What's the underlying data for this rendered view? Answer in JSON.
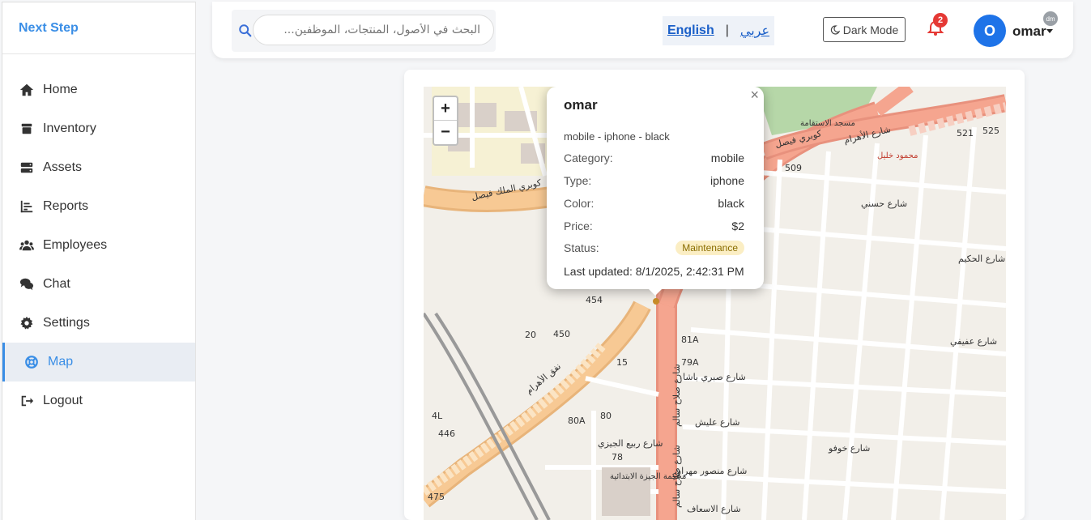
{
  "brand": "Next Step",
  "sidebar": {
    "items": [
      {
        "label": "Home"
      },
      {
        "label": "Inventory"
      },
      {
        "label": "Assets"
      },
      {
        "label": "Reports"
      },
      {
        "label": "Employees"
      },
      {
        "label": "Chat"
      },
      {
        "label": "Settings"
      },
      {
        "label": "Map"
      },
      {
        "label": "Logout"
      }
    ],
    "active": "Map"
  },
  "header": {
    "search_placeholder": "البحث في الأصول، المنتجات، الموظفين...",
    "lang_en": "English",
    "lang_sep": "|",
    "lang_ar": "عربي",
    "dark_mode": "Dark Mode",
    "notif_count": "2",
    "avatar_initial": "O",
    "user_name": "omar",
    "dm_badge": "dm"
  },
  "map": {
    "zoom_in": "+",
    "zoom_out": "−",
    "labels": {
      "kobry_faisal": "كوبري الملك فيصل",
      "kobry_faisal2": "كوبري فيصل",
      "haram": "شارع الأهرام",
      "nafaq": "نفق الأهرام",
      "salah_salem": "شارع صلاح سالم",
      "sabry": "شارع صبري باشا",
      "elaish": "شارع عليش",
      "rabie": "شارع ربيع الجيزي",
      "mansour": "شارع منصور مهران",
      "asaf": "شارع الاسعاف",
      "court": "محكمة الجيزة الابتدائية",
      "mosque": "مسجد الاستقامة",
      "mahmoud": "محمود خليل",
      "afifi": "شارع عفيفي",
      "khofo": "شارع خوفو",
      "hosny": "شارع حسني",
      "hakim": "شارع الحكيم",
      "n454": "454",
      "n450": "450",
      "n20": "20",
      "n15": "15",
      "n80a": "80A",
      "n80": "80",
      "n78": "78",
      "n446": "446",
      "n4l": "4L",
      "n509": "509",
      "n521": "521",
      "n525": "525",
      "n81a": "81A",
      "n79a": "79A",
      "n475": "475"
    }
  },
  "popup": {
    "close": "×",
    "title": "omar",
    "subtitle": "mobile - iphone - black",
    "rows": [
      {
        "label": "Category:",
        "value": "mobile"
      },
      {
        "label": "Type:",
        "value": "iphone"
      },
      {
        "label": "Color:",
        "value": "black"
      },
      {
        "label": "Price:",
        "value": "$2"
      },
      {
        "label": "Status:",
        "value": "Maintenance"
      }
    ],
    "updated_label": "Last updated:",
    "updated_value": "8/1/2025, 2:42:31 PM"
  },
  "colors": {
    "accent": "#3a8ee6",
    "avatar": "#1e73e8",
    "badge": "#e53935",
    "status_bg": "#fbeec4",
    "road_primary": "#e8917d",
    "road_secondary": "#f7c994"
  }
}
